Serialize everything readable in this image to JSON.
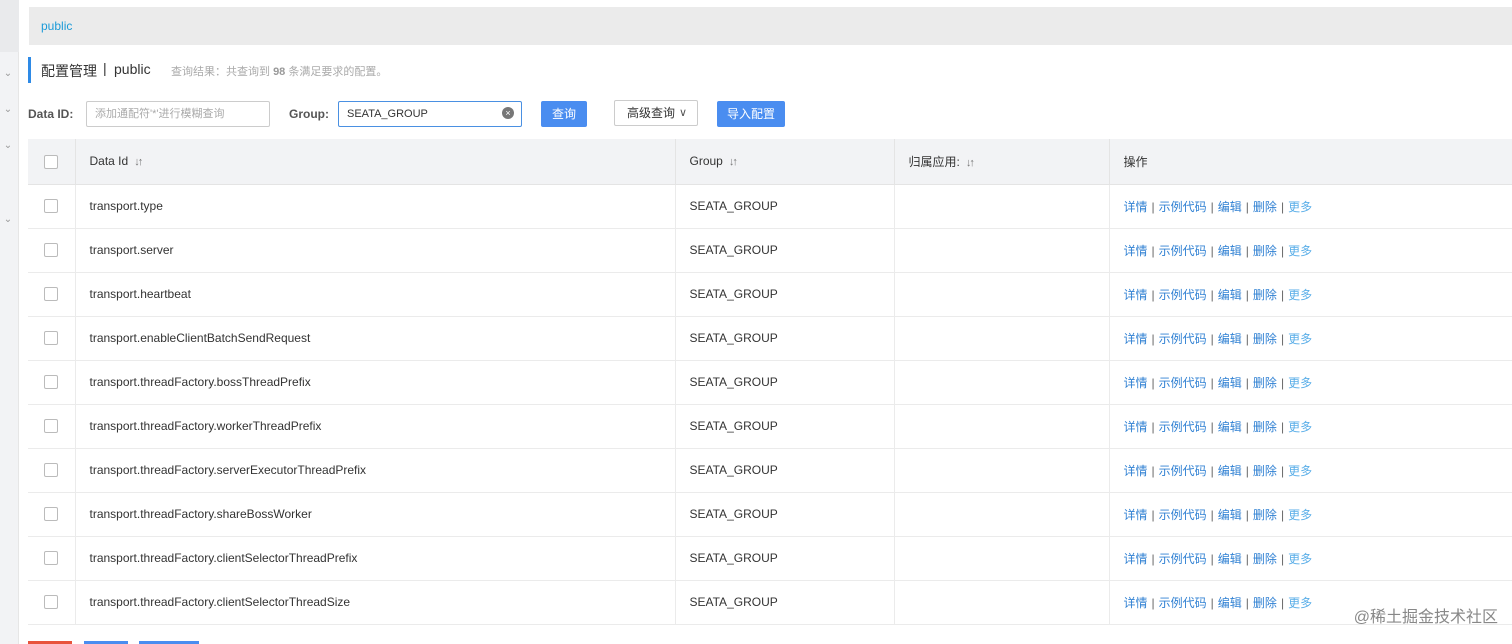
{
  "namespace_bar": {
    "label": "public"
  },
  "header": {
    "title": "配置管理",
    "separator": "|",
    "namespace": "public",
    "result_prefix": "查询结果：共查询到",
    "result_count": "98",
    "result_suffix": "条满足要求的配置。"
  },
  "search": {
    "dataid_label": "Data ID:",
    "dataid_placeholder": "添加通配符'*'进行模糊查询",
    "group_label": "Group:",
    "group_value": "SEATA_GROUP",
    "query_button": "查询",
    "advanced_button": "高级查询",
    "import_button": "导入配置"
  },
  "table": {
    "columns": {
      "dataid": "Data Id",
      "group": "Group",
      "app": "归属应用:",
      "ops": "操作"
    },
    "sort_icon": "↓↑",
    "rows": [
      {
        "dataid": "transport.type",
        "group": "SEATA_GROUP",
        "app": ""
      },
      {
        "dataid": "transport.server",
        "group": "SEATA_GROUP",
        "app": ""
      },
      {
        "dataid": "transport.heartbeat",
        "group": "SEATA_GROUP",
        "app": ""
      },
      {
        "dataid": "transport.enableClientBatchSendRequest",
        "group": "SEATA_GROUP",
        "app": ""
      },
      {
        "dataid": "transport.threadFactory.bossThreadPrefix",
        "group": "SEATA_GROUP",
        "app": ""
      },
      {
        "dataid": "transport.threadFactory.workerThreadPrefix",
        "group": "SEATA_GROUP",
        "app": ""
      },
      {
        "dataid": "transport.threadFactory.serverExecutorThreadPrefix",
        "group": "SEATA_GROUP",
        "app": ""
      },
      {
        "dataid": "transport.threadFactory.shareBossWorker",
        "group": "SEATA_GROUP",
        "app": ""
      },
      {
        "dataid": "transport.threadFactory.clientSelectorThreadPrefix",
        "group": "SEATA_GROUP",
        "app": ""
      },
      {
        "dataid": "transport.threadFactory.clientSelectorThreadSize",
        "group": "SEATA_GROUP",
        "app": ""
      }
    ],
    "actions": {
      "detail": "详情",
      "sample": "示例代码",
      "edit": "编辑",
      "delete": "删除",
      "more": "更多",
      "pipe": "|"
    }
  },
  "watermark": "@稀土掘金技术社区",
  "colors": {
    "primary": "#4a8df0",
    "link": "#3081d3",
    "accent_bar": "#2e8ae6"
  }
}
